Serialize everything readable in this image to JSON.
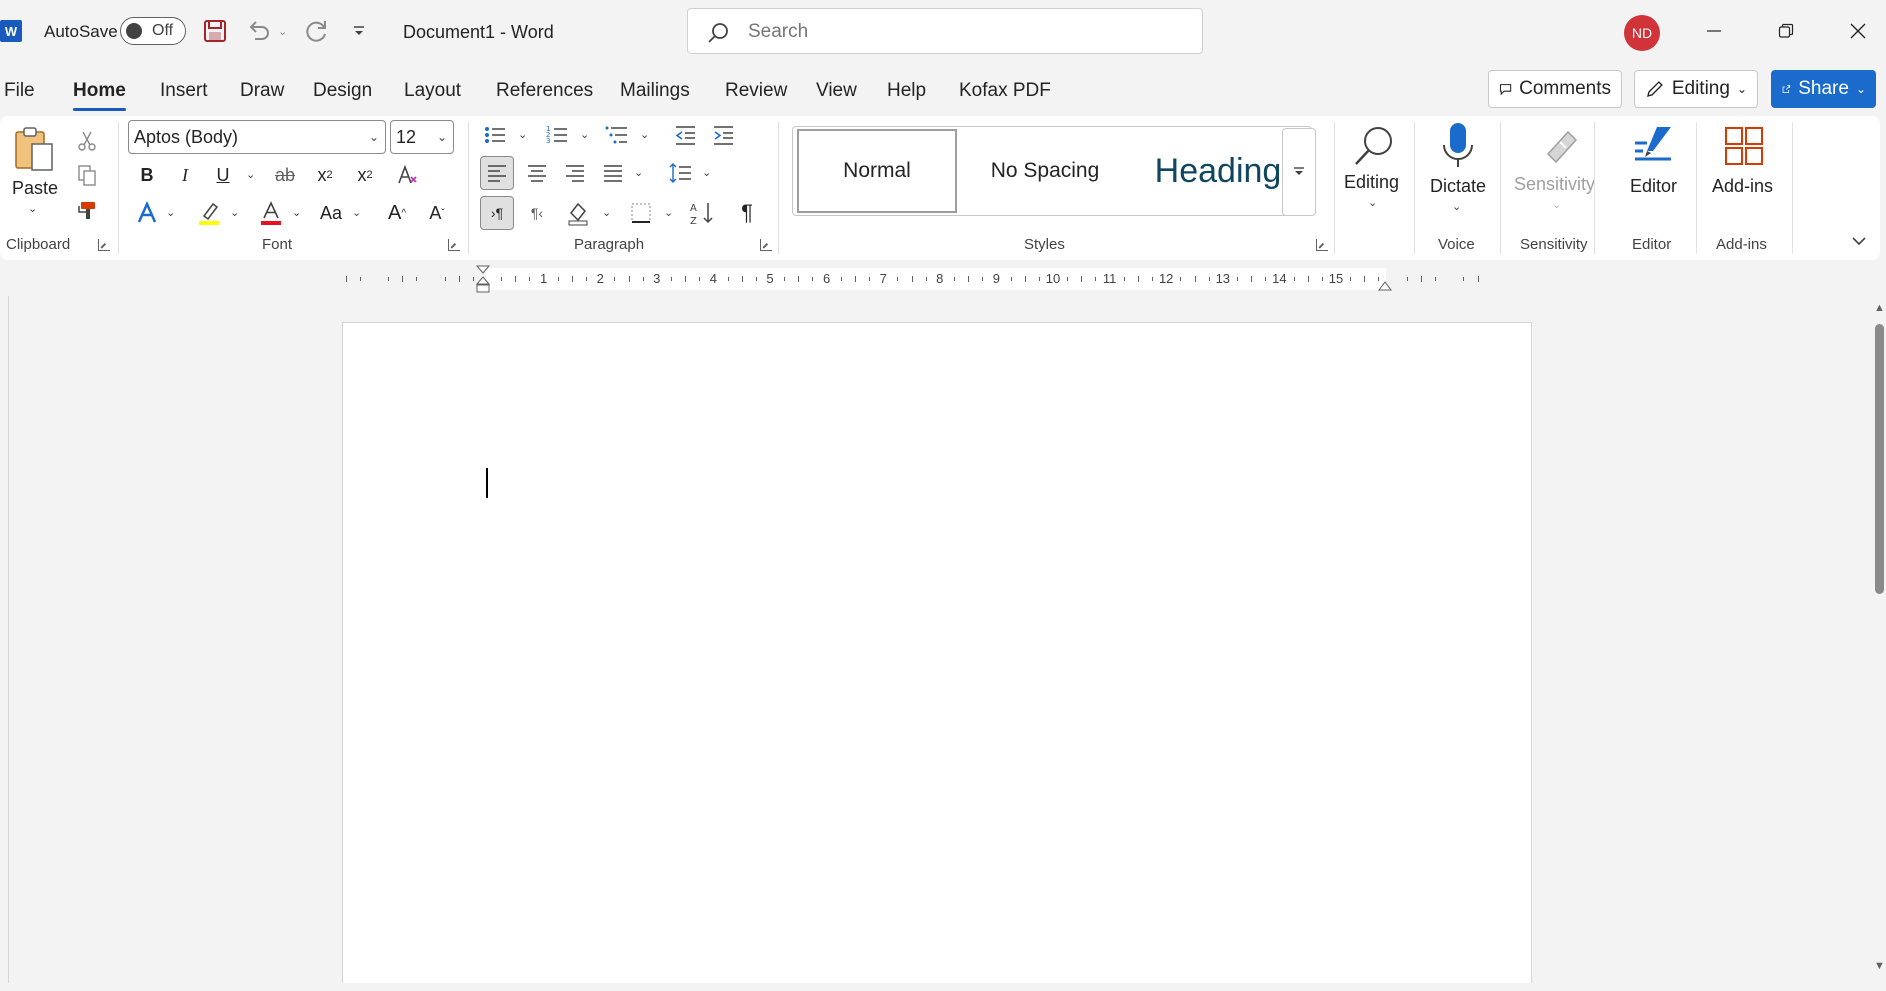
{
  "app": {
    "logo_letter": "W",
    "autosave_label": "AutoSave",
    "autosave_state": "Off",
    "document_title": "Document1  -  Word",
    "search_placeholder": "Search",
    "user_initials": "ND",
    "accent_color": "#185abd"
  },
  "tabs": [
    "File",
    "Home",
    "Insert",
    "Draw",
    "Design",
    "Layout",
    "References",
    "Mailings",
    "Review",
    "View",
    "Help",
    "Kofax PDF"
  ],
  "active_tab": "Home",
  "top_right": {
    "comments_label": "Comments",
    "editing_label": "Editing",
    "share_label": "Share"
  },
  "ribbon": {
    "clipboard": {
      "label": "Clipboard",
      "paste_label": "Paste"
    },
    "font": {
      "label": "Font",
      "font_name": "Aptos (Body)",
      "font_size": "12"
    },
    "paragraph": {
      "label": "Paragraph"
    },
    "styles": {
      "label": "Styles",
      "items": [
        "Normal",
        "No Spacing",
        "Heading"
      ]
    },
    "editing": {
      "label": "Editing"
    },
    "voice": {
      "label": "Voice",
      "dictate_label": "Dictate"
    },
    "sensitivity": {
      "label": "Sensitivity",
      "button_label": "Sensitivity"
    },
    "editor": {
      "label": "Editor",
      "button_label": "Editor"
    },
    "addins": {
      "label": "Add-ins",
      "button_label": "Add-ins"
    }
  },
  "ruler": {
    "numbers": [
      "1",
      "2",
      "3",
      "4",
      "5",
      "6",
      "7",
      "8",
      "9",
      "10",
      "11",
      "12",
      "13",
      "14",
      "15"
    ]
  }
}
